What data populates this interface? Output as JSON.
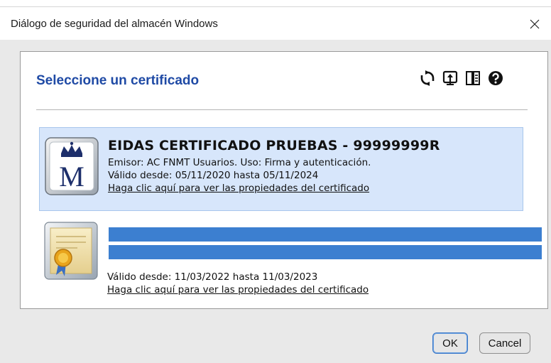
{
  "window": {
    "title": "Diálogo de seguridad del almacén Windows",
    "close_icon": "close-icon"
  },
  "dialog": {
    "heading": "Seleccione un certificado",
    "toolbar": [
      {
        "icon": "refresh-icon"
      },
      {
        "icon": "import-icon"
      },
      {
        "icon": "details-icon"
      },
      {
        "icon": "help-icon"
      }
    ]
  },
  "certificates": [
    {
      "icon": "royal-mint-crown-m-icon",
      "name": "EIDAS CERTIFICADO PRUEBAS - 99999999R",
      "issuer": "Emisor: AC FNMT Usuarios. Uso: Firma y autenticación.",
      "validity": "Válido desde: 05/11/2020 hasta 05/11/2024",
      "link": "Haga clic aquí para ver las propiedades del certificado",
      "selected": true
    },
    {
      "icon": "certificate-seal-icon",
      "name": "",
      "issuer": "",
      "validity": "Válido desde: 11/03/2022 hasta 11/03/2023",
      "link": "Haga clic aquí para ver las propiedades del certificado",
      "selected": false,
      "redacted": true
    }
  ],
  "buttons": {
    "ok": "OK",
    "cancel": "Cancel"
  },
  "colors": {
    "heading": "#1f4aa5",
    "selection": "#d7e6fb",
    "redaction": "#3c7fd0"
  }
}
